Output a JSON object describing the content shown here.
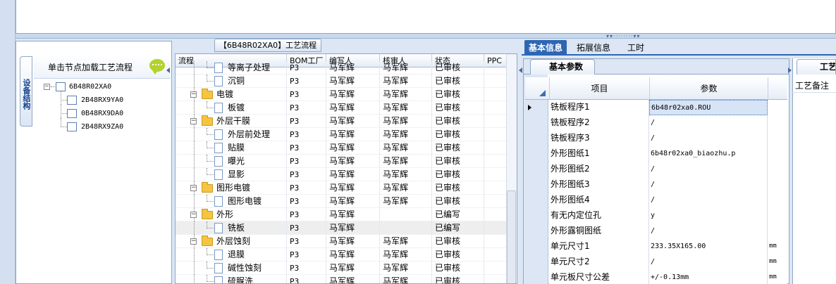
{
  "left_panel": {
    "vertical_tab": "设备结构",
    "load_hint": "单击节点加载工艺流程",
    "tree": [
      {
        "label": "6B48R02XA0",
        "level": 0,
        "expanded": true
      },
      {
        "label": "2B48RX9YA0",
        "level": 1
      },
      {
        "label": "0B48RX9DA0",
        "level": 1
      },
      {
        "label": "2B48RX9ZA0",
        "level": 1
      }
    ]
  },
  "middle_panel": {
    "title": "【6B48R02XA0】工艺流程",
    "columns": [
      "流程",
      "BOM工厂",
      "编写人",
      "核审人",
      "状态",
      "PPC"
    ],
    "rows": [
      {
        "name": "等离子处理",
        "type": "doc",
        "factory": "P3",
        "writer": "马军辉",
        "checker": "马军辉",
        "status": "已审核"
      },
      {
        "name": "沉铜",
        "type": "doc",
        "factory": "P3",
        "writer": "马军辉",
        "checker": "马军辉",
        "status": "已审核"
      },
      {
        "name": "电镀",
        "type": "folder",
        "factory": "P3",
        "writer": "马军辉",
        "checker": "马军辉",
        "status": "已审核"
      },
      {
        "name": "板镀",
        "type": "doc",
        "factory": "P3",
        "writer": "马军辉",
        "checker": "马军辉",
        "status": "已审核"
      },
      {
        "name": "外层干膜",
        "type": "folder",
        "factory": "P3",
        "writer": "马军辉",
        "checker": "马军辉",
        "status": "已审核"
      },
      {
        "name": "外层前处理",
        "type": "doc",
        "factory": "P3",
        "writer": "马军辉",
        "checker": "马军辉",
        "status": "已审核"
      },
      {
        "name": "贴膜",
        "type": "doc",
        "factory": "P3",
        "writer": "马军辉",
        "checker": "马军辉",
        "status": "已审核"
      },
      {
        "name": "曝光",
        "type": "doc",
        "factory": "P3",
        "writer": "马军辉",
        "checker": "马军辉",
        "status": "已审核"
      },
      {
        "name": "显影",
        "type": "doc",
        "factory": "P3",
        "writer": "马军辉",
        "checker": "马军辉",
        "status": "已审核"
      },
      {
        "name": "图形电镀",
        "type": "folder",
        "factory": "P3",
        "writer": "马军辉",
        "checker": "马军辉",
        "status": "已审核"
      },
      {
        "name": "图形电镀",
        "type": "doc",
        "factory": "P3",
        "writer": "马军辉",
        "checker": "马军辉",
        "status": "已审核"
      },
      {
        "name": "外形",
        "type": "folder",
        "factory": "P3",
        "writer": "马军辉",
        "checker": "",
        "status": "已编写"
      },
      {
        "name": "铣板",
        "type": "doc",
        "factory": "P3",
        "writer": "马军辉",
        "checker": "",
        "status": "已编写",
        "selected": true
      },
      {
        "name": "外层蚀刻",
        "type": "folder",
        "factory": "P3",
        "writer": "马军辉",
        "checker": "马军辉",
        "status": "已审核"
      },
      {
        "name": "退膜",
        "type": "doc",
        "factory": "P3",
        "writer": "马军辉",
        "checker": "马军辉",
        "status": "已审核"
      },
      {
        "name": "碱性蚀刻",
        "type": "doc",
        "factory": "P3",
        "writer": "马军辉",
        "checker": "马军辉",
        "status": "已审核"
      },
      {
        "name": "硫脲洗",
        "type": "doc",
        "factory": "P3",
        "writer": "马军辉",
        "checker": "马军辉",
        "status": "已审核"
      }
    ]
  },
  "right_panel": {
    "tabs": [
      "基本信息",
      "拓展信息",
      "工时"
    ],
    "active_tab": 0,
    "sub_tab": "基本参数",
    "grid_columns": [
      "项目",
      "参数"
    ],
    "params": [
      {
        "item": "铣板程序1",
        "value": "6b48r02xa0.ROU",
        "unit": "",
        "current": true
      },
      {
        "item": "铣板程序2",
        "value": "/",
        "unit": ""
      },
      {
        "item": "铣板程序3",
        "value": "/",
        "unit": ""
      },
      {
        "item": "外形图纸1",
        "value": "6b48r02xa0_biaozhu.p",
        "unit": ""
      },
      {
        "item": "外形图纸2",
        "value": "/",
        "unit": ""
      },
      {
        "item": "外形图纸3",
        "value": "/",
        "unit": ""
      },
      {
        "item": "外形图纸4",
        "value": "/",
        "unit": ""
      },
      {
        "item": "有无内定位孔",
        "value": "y",
        "unit": ""
      },
      {
        "item": "外形露铜图纸",
        "value": "/",
        "unit": ""
      },
      {
        "item": "单元尺寸1",
        "value": "233.35X165.00",
        "unit": "mm"
      },
      {
        "item": "单元尺寸2",
        "value": "/",
        "unit": "mm"
      },
      {
        "item": "单元板尺寸公差",
        "value": "+/-0.13mm",
        "unit": "mm"
      }
    ],
    "far_tab": "工艺",
    "far_label": "工艺备注"
  },
  "splitter_grip": "▾▾········▾▾"
}
